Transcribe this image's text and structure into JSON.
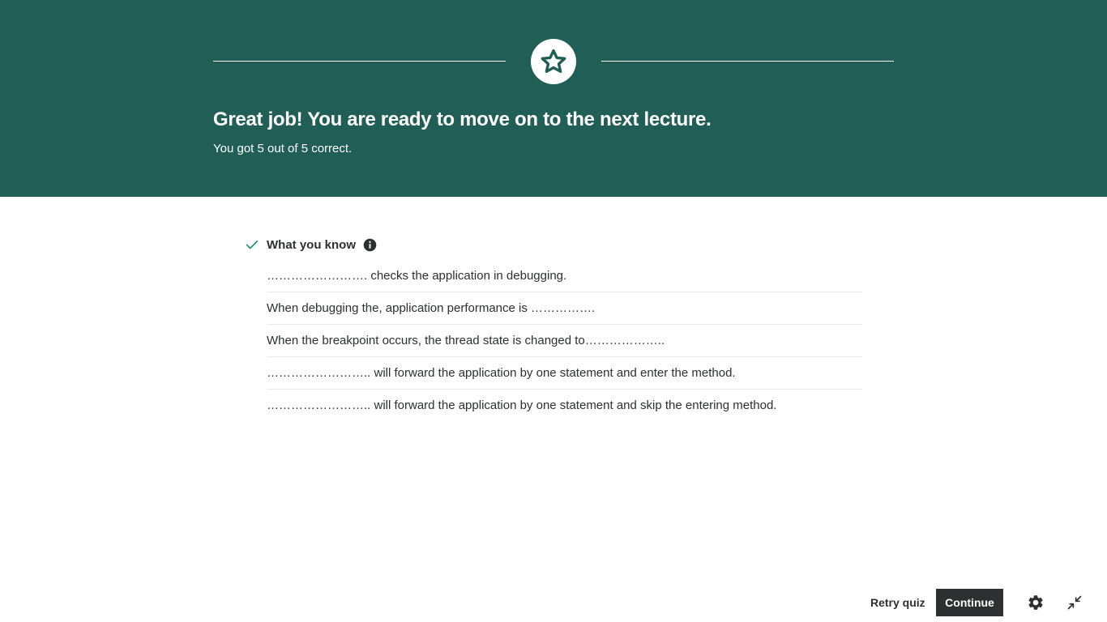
{
  "banner": {
    "title": "Great job! You are ready to move on to the next lecture.",
    "subtitle": "You got 5 out of 5 correct.",
    "icon": "star-icon",
    "background_color": "#215f56"
  },
  "section": {
    "title": "What you know",
    "icons": [
      "check-icon",
      "info-icon"
    ],
    "accent_color": "#1e8f71",
    "items": [
      "……………………. checks the application in debugging.",
      "When debugging the, application performance is …………….",
      "When the breakpoint occurs, the thread state is changed to………………..",
      "…………………….. will forward the application by one statement and enter the method.",
      "…………………….. will forward the application by one statement and skip the entering method."
    ]
  },
  "footer": {
    "retry_label": "Retry quiz",
    "continue_label": "Continue",
    "icons": [
      "gear-icon",
      "collapse-icon"
    ]
  }
}
